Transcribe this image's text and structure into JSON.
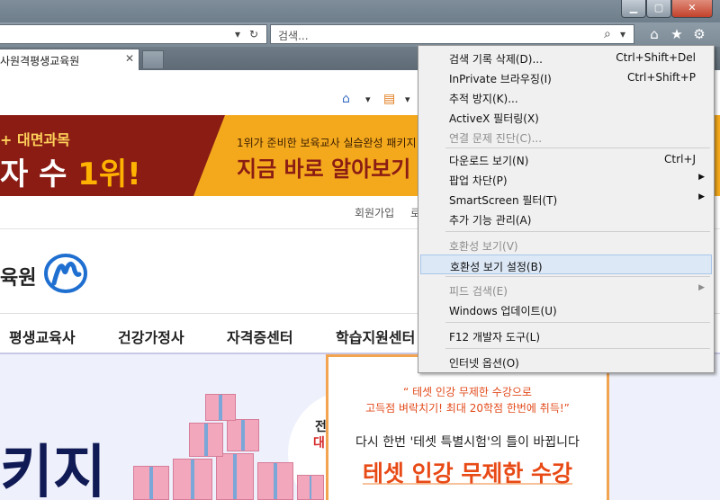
{
  "browser": {
    "window_buttons": {
      "minimize": "▁",
      "maximize": "▢",
      "close": "✕"
    },
    "address_glyphs": {
      "dropdown": "▾",
      "refresh": "↻"
    },
    "search": {
      "placeholder": "검색...",
      "search_glyph": "⌕",
      "dropdown": "▾"
    },
    "toolbar_icons": {
      "home": "⌂",
      "favorites": "★",
      "tools": "⚙"
    },
    "tab": {
      "title": "사원격평생교육원",
      "close": "✕"
    }
  },
  "page": {
    "command_bar": {
      "home": "⌂",
      "home_drop": "▾",
      "feeds": "▤",
      "feeds_drop": "▾"
    },
    "banner": {
      "tag": "+ 대면과목",
      "headline_prefix": "자 수 ",
      "headline_accent": "1위!",
      "promo": "1위가 준비한 보육교사 실습완성 패키지!",
      "cta": "지금 바로 알아보기"
    },
    "util_links": [
      "회원가입",
      "로"
    ],
    "logo": {
      "text": "육원"
    },
    "gnb": [
      "평생교육사",
      "건강가정사",
      "자격증센터",
      "학습지원센터"
    ],
    "hero": {
      "big_text": "키지",
      "side_line1": "전",
      "side_line2": "대"
    },
    "popup": {
      "quote_line1": "“ 테셋 인강 무제한 수강으로",
      "quote_line2": "고득점 벼락치기! 최대 20학점 한번에 취득!”",
      "desc": "다시 한번 '테셋 특별시험'의 틀이 바뀝니다",
      "title": "테셋 인강 무제한 수강"
    }
  },
  "tools_menu": {
    "items": [
      {
        "label": "검색 기록 삭제(D)...",
        "shortcut": "Ctrl+Shift+Del"
      },
      {
        "label": "InPrivate 브라우징(I)",
        "shortcut": "Ctrl+Shift+P"
      },
      {
        "label": "추적 방지(K)..."
      },
      {
        "label": "ActiveX 필터링(X)"
      },
      {
        "label": "연결 문제 진단(C)..."
      },
      {
        "label": "다운로드 보기(N)",
        "shortcut": "Ctrl+J"
      },
      {
        "label": "팝업 차단(P)"
      },
      {
        "label": "SmartScreen 필터(T)"
      },
      {
        "label": "추가 기능 관리(A)"
      },
      {
        "label": "호환성 보기(V)"
      },
      {
        "label": "호환성 보기 설정(B)"
      },
      {
        "label": "피드 검색(E)"
      },
      {
        "label": "Windows 업데이트(U)"
      },
      {
        "label": "F12 개발자 도구(L)"
      },
      {
        "label": "인터넷 옵션(O)"
      }
    ],
    "submenu_arrow": "▶"
  },
  "colors": {
    "accent_menu_highlight": "#dce8f6",
    "banner_dark_red": "#8a1c14",
    "banner_orange": "#f4a91d",
    "popup_orange": "#e84a16"
  }
}
